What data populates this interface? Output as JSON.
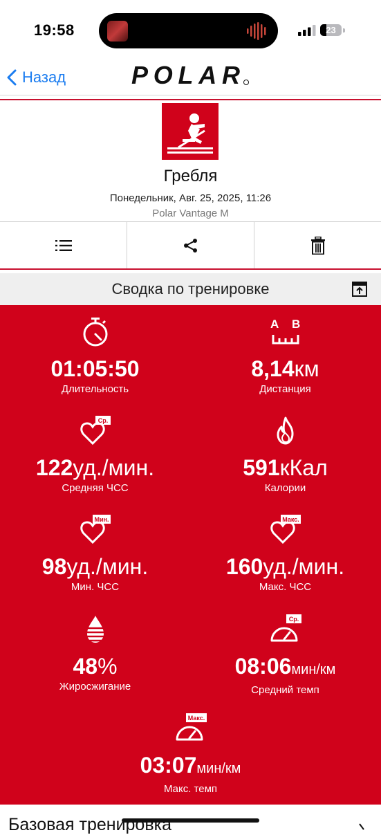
{
  "status_bar": {
    "time": "19:58",
    "battery": "23"
  },
  "nav": {
    "back_label": "Назад",
    "logo_text": "POLAR"
  },
  "activity": {
    "sport": "Гребля",
    "datetime": "Понедельник, Авг. 25, 2025, 11:26",
    "device": "Polar Vantage M"
  },
  "summary": {
    "title": "Сводка по тренировке"
  },
  "metrics": [
    {
      "icon": "stopwatch-icon",
      "value": "01:05:50",
      "unit": "",
      "label": "Длительность"
    },
    {
      "icon": "distance-ab-icon",
      "value": "8,14",
      "unit": "км",
      "label": "Дистанция",
      "icon_text_a": "A",
      "icon_text_b": "B"
    },
    {
      "icon": "heart-avg-icon",
      "badge": "Ср.",
      "value": "122",
      "unit": "уд./мин.",
      "label": "Средняя ЧСС"
    },
    {
      "icon": "flame-icon",
      "value": "591",
      "unit": "кКал",
      "label": "Калории"
    },
    {
      "icon": "heart-min-icon",
      "badge": "Мин.",
      "value": "98",
      "unit": "уд./мин.",
      "label": "Мин. ЧСС"
    },
    {
      "icon": "heart-max-icon",
      "badge": "Макс.",
      "value": "160",
      "unit": "уд./мин.",
      "label": "Макс. ЧСС"
    },
    {
      "icon": "fat-burn-icon",
      "value": "48",
      "unit": "%",
      "label": "Жиросжигание"
    },
    {
      "icon": "speedometer-avg-icon",
      "badge": "Ср.",
      "value": "08:06",
      "unit": "мин/км",
      "label": "Средний темп"
    },
    {
      "icon": "speedometer-max-icon",
      "badge": "Макс.",
      "value": "03:07",
      "unit": "мин/км",
      "label": "Макс. темп"
    }
  ],
  "bottom": {
    "section_title": "Базовая тренировка"
  },
  "colors": {
    "accent": "#d0021b",
    "link": "#1a7cf0"
  }
}
